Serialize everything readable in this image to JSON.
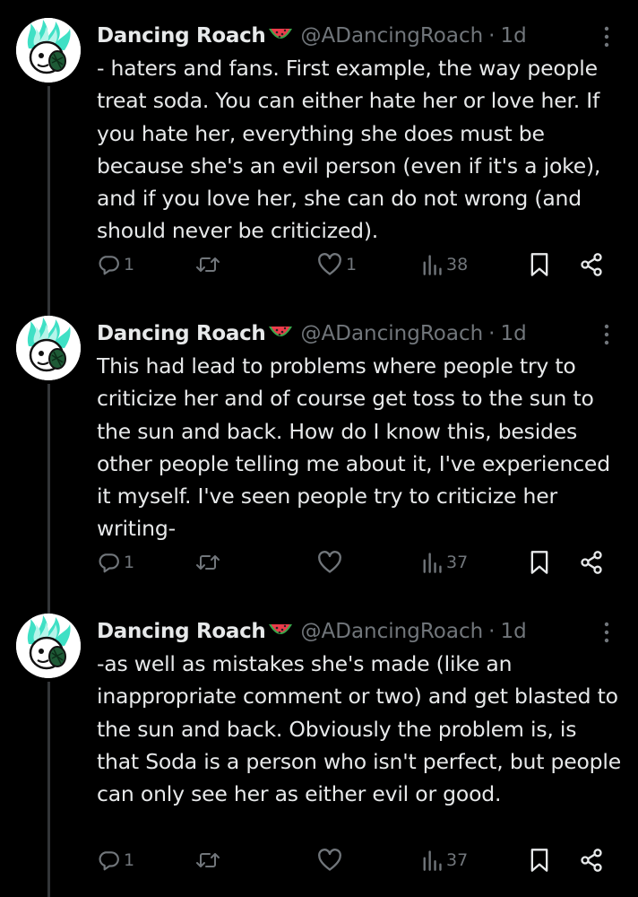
{
  "tweets": [
    {
      "author": "Dancing Roach",
      "handle": "@ADancingRoach",
      "separator": "·",
      "time": "1d",
      "text": "- haters and fans. First example, the way people treat soda. You can either hate her or love her. If you hate her, everything she does must be because she's an evil person (even if it's a joke), and if you love her, she can do not wrong (and should never be criticized).",
      "replies": "1",
      "reposts": "",
      "likes": "1",
      "views": "38"
    },
    {
      "author": "Dancing Roach",
      "handle": "@ADancingRoach",
      "separator": "·",
      "time": "1d",
      "text": "This had lead to problems where people try to criticize her and of course get toss to the sun to the sun and back. How do I know this, besides other people telling me about it, I've experienced it myself. I've seen people try to criticize her writing-",
      "replies": "1",
      "reposts": "",
      "likes": "",
      "views": "37"
    },
    {
      "author": "Dancing Roach",
      "handle": "@ADancingRoach",
      "separator": "·",
      "time": "1d",
      "text": "-as well as mistakes she's made (like an inappropriate comment or two) and get blasted to the sun and back. Obviously the problem is, is that Soda is a person who isn't perfect, but people can only see her as either evil or good.",
      "replies": "1",
      "reposts": "",
      "likes": "",
      "views": "37"
    }
  ],
  "icons": {
    "author_emoji": "watermelon-icon",
    "avatar": "green-flame-character",
    "more": "more-vertical-icon",
    "reply": "reply-icon",
    "repost": "repost-icon",
    "like": "heart-icon",
    "views": "views-chart-icon",
    "bookmark": "bookmark-icon",
    "share": "share-icon"
  },
  "colors": {
    "background": "#000000",
    "text": "#e7e9ea",
    "muted": "#71767b",
    "thread_line": "#333639",
    "avatar_accent": "#3fe0c5"
  }
}
